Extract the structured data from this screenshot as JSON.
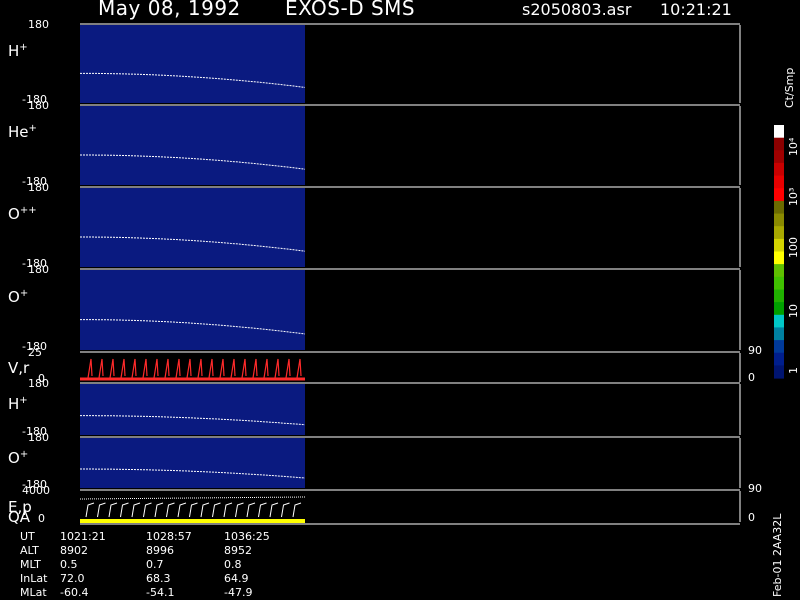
{
  "header": {
    "date": "May 08, 1992",
    "instrument": "EXOS-D SMS",
    "filename": "s2050803.asr",
    "time": "10:21:21"
  },
  "colors": {
    "background": "#000000",
    "panel_fill": "#0a1a80",
    "trace": "#ffffff",
    "vr_trace": "#ff2a2a",
    "qa_bar": "#ffff00"
  },
  "chart_data": [
    {
      "type": "heatmap",
      "name": "H+",
      "label": "H",
      "sup": "+",
      "yticks": [
        "180",
        "-180"
      ],
      "ylim": [
        -180,
        180
      ]
    },
    {
      "type": "heatmap",
      "name": "He+",
      "label": "He",
      "sup": "+",
      "yticks": [
        "180",
        "-180"
      ],
      "ylim": [
        -180,
        180
      ]
    },
    {
      "type": "heatmap",
      "name": "O++",
      "label": "O",
      "sup": "++",
      "yticks": [
        "180",
        "-180"
      ],
      "ylim": [
        -180,
        180
      ]
    },
    {
      "type": "heatmap",
      "name": "O+",
      "label": "O",
      "sup": "+",
      "yticks": [
        "180",
        "-180"
      ],
      "ylim": [
        -180,
        180
      ]
    },
    {
      "type": "line",
      "name": "V,r",
      "label": "V,r",
      "sup": "",
      "yticks": [
        "25",
        "0"
      ],
      "ylim": [
        0,
        25
      ],
      "right_ticks": [
        "90",
        "0"
      ]
    },
    {
      "type": "heatmap",
      "name": "H+ (2)",
      "label": "H",
      "sup": "+",
      "yticks": [
        "180",
        "-180"
      ],
      "ylim": [
        -180,
        180
      ]
    },
    {
      "type": "heatmap",
      "name": "O+ (2)",
      "label": "O",
      "sup": "+",
      "yticks": [
        "180",
        "-180"
      ],
      "ylim": [
        -180,
        180
      ]
    },
    {
      "type": "line",
      "name": "E,p",
      "label": "E,p",
      "sup": "",
      "yticks": [
        "4000",
        "0"
      ],
      "ylim": [
        0,
        4000
      ],
      "right_ticks": [
        "90",
        "0"
      ]
    }
  ],
  "qa_label": "QA",
  "colorbar": {
    "unit": "Ct/Smp",
    "ticks": [
      "10⁴",
      "10³",
      "100",
      "10",
      "1"
    ],
    "colors": [
      "#ffffff",
      "#8b0000",
      "#a00000",
      "#c80000",
      "#e60000",
      "#ff0000",
      "#6b6b00",
      "#8a8a00",
      "#a8a800",
      "#d4d400",
      "#ffff00",
      "#5fbf00",
      "#40c000",
      "#20b000",
      "#00a000",
      "#00c8c8",
      "#0080a0",
      "#003a9a",
      "#001e8c",
      "#001470"
    ]
  },
  "footer": {
    "rows": [
      {
        "label": "UT",
        "values": [
          "1021:21",
          "1028:57",
          "1036:25"
        ]
      },
      {
        "label": "ALT",
        "values": [
          "8902",
          "8996",
          "8952"
        ]
      },
      {
        "label": "MLT",
        "values": [
          "0.5",
          "0.7",
          "0.8"
        ]
      },
      {
        "label": "InLat",
        "values": [
          "72.0",
          "68.3",
          "64.9"
        ]
      },
      {
        "label": "MLat",
        "values": [
          "-60.4",
          "-54.1",
          "-47.9"
        ]
      }
    ],
    "stamp": "Feb-01 2AA32L"
  }
}
